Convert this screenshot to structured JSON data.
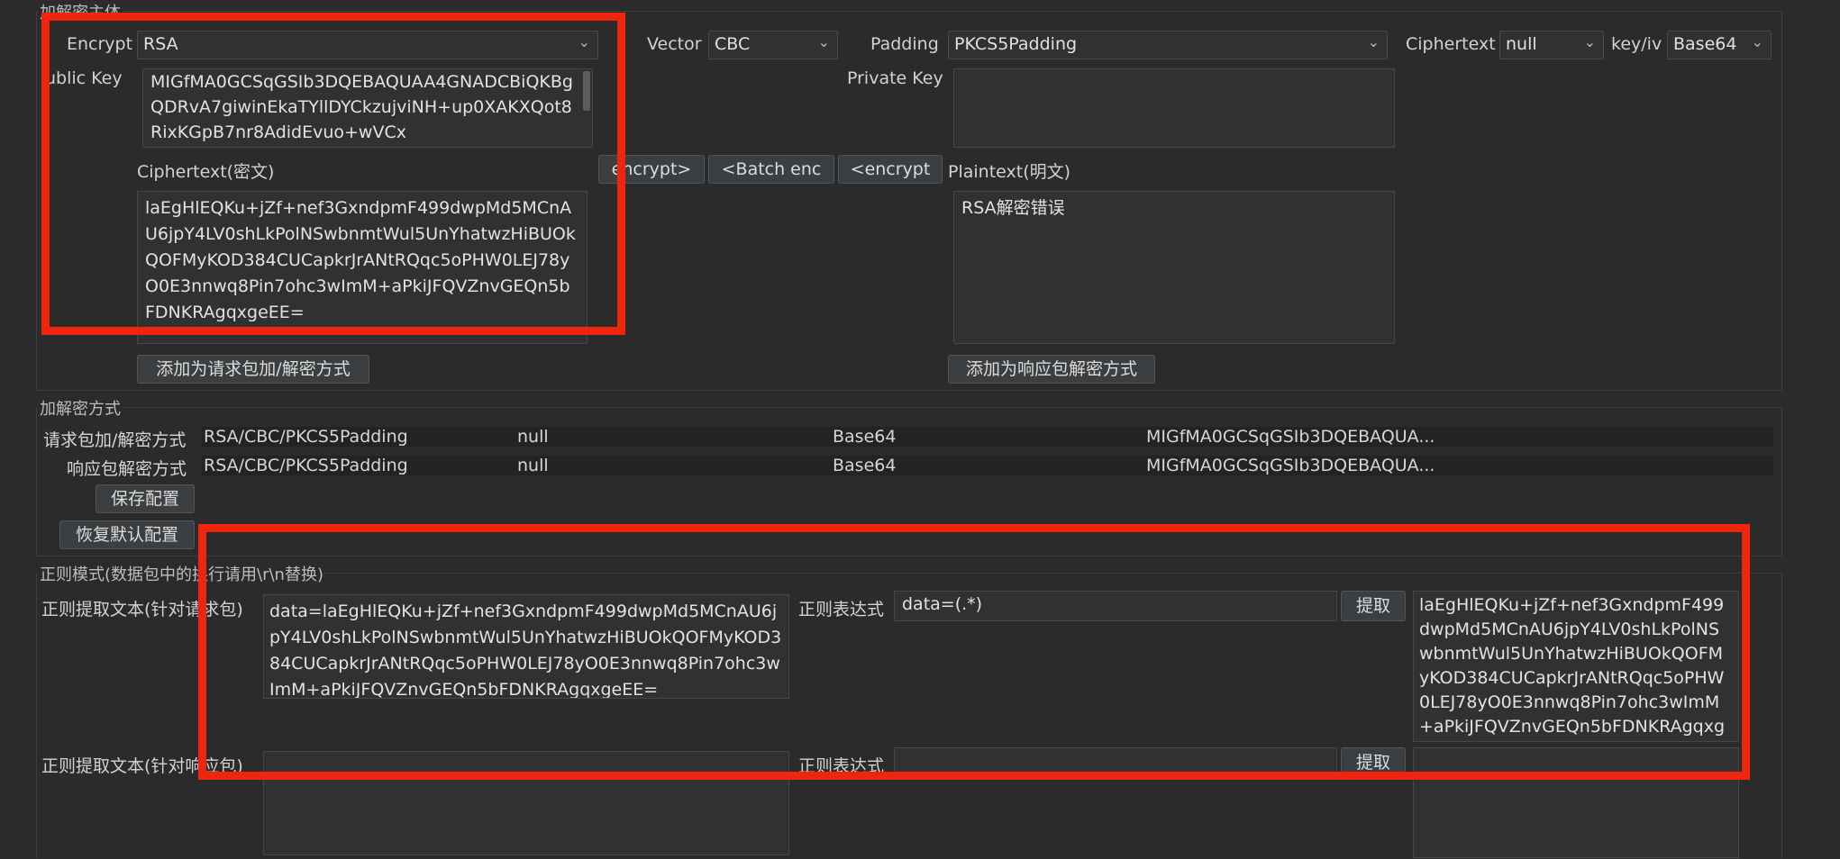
{
  "top": {
    "group_title": "加解密主体",
    "encrypt_label": "Encrypt",
    "encrypt_value": "RSA",
    "vector_label": "Vector",
    "vector_value": "CBC",
    "padding_label": "Padding",
    "padding_value": "PKCS5Padding",
    "ciphertext_label": "Ciphertext",
    "ciphertext_value": "null",
    "keyiv_label": "key/iv",
    "keyiv_value": "Base64",
    "public_key_label": "ublic Key",
    "public_key_value": "MIGfMA0GCSqGSIb3DQEBAQUAA4GNADCBiQKBgQDRvA7giwinEkaTYllDYCkzujviNH+up0XAKXQot8RixKGpB7nr8AdidEvuo+wVCx",
    "private_key_label": "Private Key",
    "private_key_value": "",
    "cipher_area_label": "Ciphertext(密文)",
    "cipher_area_value": "laEgHlEQKu+jZf+nef3GxndpmF499dwpMd5MCnAU6jpY4LV0shLkPolNSwbnmtWul5UnYhatwzHiBUOkQOFMyKOD384CUCapkrJrANtRQqc5oPHW0LEJ78yO0E3nnwq8Pin7ohc3wImM+aPkiJFQVZnvGEQn5bFDNKRAgqxgeEE=",
    "plain_area_label": "Plaintext(明文)",
    "plain_area_value": "RSA解密错误",
    "btn_encrypt": "encrypt>",
    "btn_batch": "<Batch enc",
    "btn_decrypt": "<encrypt",
    "btn_add_request": "添加为请求包加/解密方式",
    "btn_add_response": "添加为响应包解密方式"
  },
  "methods": {
    "group_title": "加解密方式",
    "rows": [
      {
        "label": "请求包加/解密方式",
        "algo": "RSA/CBC/PKCS5Padding",
        "cipher": "null",
        "encoding": "Base64",
        "key": "MIGfMA0GCSqGSIb3DQEBAQUA..."
      },
      {
        "label": "响应包解密方式",
        "algo": "RSA/CBC/PKCS5Padding",
        "cipher": "null",
        "encoding": "Base64",
        "key": "MIGfMA0GCSqGSIb3DQEBAQUA..."
      }
    ],
    "btn_save": "保存配置",
    "btn_restore": "恢复默认配置"
  },
  "regex": {
    "group_title": "正则模式(数据包中的换行请用\\r\\n替换)",
    "req_label": "正则提取文本(针对请求包)",
    "req_text": "data=laEgHlEQKu+jZf+nef3GxndpmF499dwpMd5MCnAU6jpY4LV0shLkPolNSwbnmtWul5UnYhatwzHiBUOkQOFMyKOD384CUCapkrJrANtRQqc5oPHW0LEJ78yO0E3nnwq8Pin7ohc3wImM+aPkiJFQVZnvGEQn5bFDNKRAgqxgeEE=",
    "req_expr_label": "正则表达式",
    "req_expr_value": "data=(.*)",
    "req_extract_btn": "提取",
    "req_result": "laEgHlEQKu+jZf+nef3GxndpmF499dwpMd5MCnAU6jpY4LV0shLkPolNSwbnmtWul5UnYhatwzHiBUOkQOFMyKOD384CUCapkrJrANtRQqc5oPHW0LEJ78yO0E3nnwq8Pin7ohc3wImM+aPkiJFQVZnvGEQn5bFDNKRAgqxgeEE=",
    "resp_label": "正则提取文本(针对响应包)",
    "resp_text": "",
    "resp_expr_label": "正则表达式",
    "resp_expr_value": "",
    "resp_extract_btn": "提取",
    "resp_result": ""
  },
  "colors": {
    "background": "#2b2b2b",
    "highlight": "#f0250e"
  }
}
